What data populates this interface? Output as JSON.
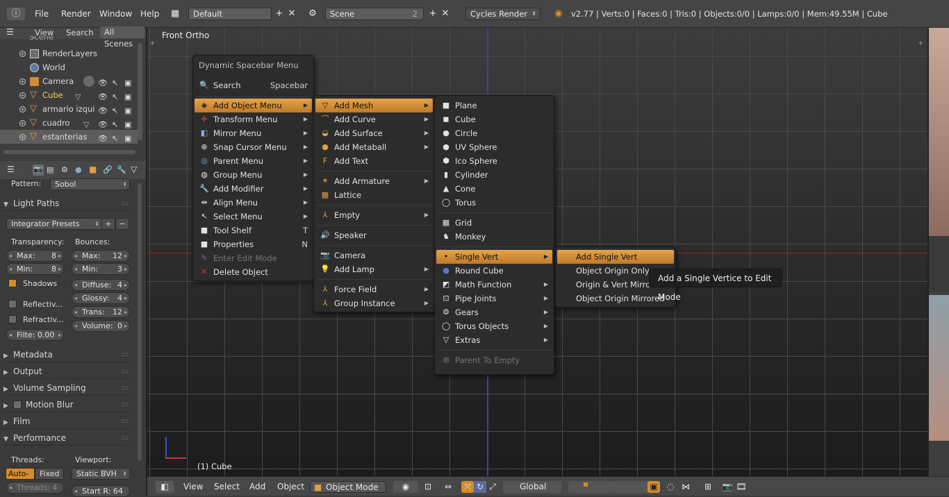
{
  "topbar": {
    "menus": [
      "File",
      "Render",
      "Window",
      "Help"
    ],
    "screen_layout": "Default",
    "scene": "Scene",
    "scene_users": "2",
    "render_engine": "Cycles Render",
    "stats": "v2.77 | Verts:0 | Faces:0 | Tris:0 | Objects:0/0 | Lamps:0/0 | Mem:49.55M | Cube"
  },
  "outliner": {
    "header_buttons": [
      "View",
      "Search",
      "All Scenes"
    ],
    "partial_top": "Scene",
    "rows": [
      {
        "label": "RenderLayers",
        "icon": "render-layers-icon"
      },
      {
        "label": "World",
        "icon": "world-icon"
      },
      {
        "label": "Camera",
        "icon": "camera-icon"
      },
      {
        "label": "Cube",
        "icon": "mesh-icon",
        "active": true
      },
      {
        "label": "armario izquier",
        "icon": "mesh-icon"
      },
      {
        "label": "cuadro",
        "icon": "mesh-icon"
      },
      {
        "label": "estanterias",
        "icon": "mesh-icon",
        "selected": true
      }
    ]
  },
  "properties": {
    "pattern_label": "Pattern:",
    "pattern_value": "Sobol",
    "light_paths": "Light Paths",
    "integrator_presets": "Integrator Presets",
    "transparency_label": "Transparency:",
    "bounces_label": "Bounces:",
    "t_max_label": "Max:",
    "t_max": "8",
    "t_min_label": "Min:",
    "t_min": "8",
    "b_max_label": "Max:",
    "b_max": "12",
    "b_min_label": "Min:",
    "b_min": "3",
    "shadows": "Shadows",
    "reflective": "Reflectiv...",
    "refractive": "Refractiv...",
    "filter_glossy": "Filte: 0.00",
    "diffuse_label": "Diffuse:",
    "diffuse": "4",
    "glossy_label": "Glossy:",
    "glossy": "4",
    "trans_label": "Trans:",
    "trans": "12",
    "volume_label": "Volume:",
    "volume": "0",
    "panels": [
      "Metadata",
      "Output",
      "Volume Sampling",
      "Motion Blur",
      "Film",
      "Performance"
    ],
    "threads_label": "Threads:",
    "viewport_label": "Viewport:",
    "auto_detect": "Auto-de",
    "fixed": "Fixed",
    "threads_value": "Threads: 4",
    "static_bvh": "Static BVH",
    "start_r": "Start R: 64"
  },
  "viewport": {
    "view_name": "Front Ortho",
    "object_label": "(1) Cube"
  },
  "menus": {
    "spacebar": {
      "title": "Dynamic Spacebar Menu",
      "search": "Search",
      "search_key": "Spacebar",
      "items": [
        {
          "label": "Add Object Menu",
          "icon": "add-object-icon",
          "submenu": true,
          "highlight": true
        },
        {
          "label": "Transform Menu",
          "icon": "transform-icon",
          "submenu": true
        },
        {
          "label": "Mirror Menu",
          "icon": "mirror-icon",
          "submenu": true
        },
        {
          "label": "Snap Cursor Menu",
          "icon": "snap-cursor-icon",
          "submenu": true
        },
        {
          "label": "Parent Menu",
          "icon": "parent-icon",
          "submenu": true
        },
        {
          "label": "Group Menu",
          "icon": "group-icon",
          "submenu": true
        },
        {
          "label": "Add Modifier",
          "icon": "wrench-icon",
          "submenu": true
        },
        {
          "label": "Align Menu",
          "icon": "align-icon",
          "submenu": true
        },
        {
          "label": "Select Menu",
          "icon": "select-icon",
          "submenu": true
        },
        {
          "label": "Tool Shelf",
          "icon": "tool-shelf-icon",
          "key": "T"
        },
        {
          "label": "Properties",
          "icon": "properties-icon",
          "key": "N"
        },
        {
          "label": "Enter Edit Mode",
          "icon": "edit-mode-icon",
          "disabled": true
        },
        {
          "label": "Delete Object",
          "icon": "delete-icon"
        }
      ]
    },
    "add_object": [
      {
        "label": "Add Mesh",
        "icon": "mesh-icon",
        "submenu": true,
        "highlight": true
      },
      {
        "label": "Add Curve",
        "icon": "curve-icon",
        "submenu": true
      },
      {
        "label": "Add Surface",
        "icon": "surface-icon",
        "submenu": true
      },
      {
        "label": "Add Metaball",
        "icon": "metaball-icon",
        "submenu": true
      },
      {
        "label": "Add Text",
        "icon": "text-icon"
      },
      {
        "label": "Add Armature",
        "icon": "armature-icon",
        "submenu": true
      },
      {
        "label": "Lattice",
        "icon": "lattice-icon"
      },
      {
        "label": "Empty",
        "icon": "empty-icon",
        "submenu": true
      },
      {
        "label": "Speaker",
        "icon": "speaker-icon"
      },
      {
        "label": "Camera",
        "icon": "camera-icon"
      },
      {
        "label": "Add Lamp",
        "icon": "lamp-icon",
        "submenu": true
      },
      {
        "label": "Force Field",
        "icon": "force-field-icon",
        "submenu": true
      },
      {
        "label": "Group Instance",
        "icon": "group-instance-icon",
        "submenu": true
      }
    ],
    "add_mesh": [
      {
        "label": "Plane",
        "icon": "plane-icon"
      },
      {
        "label": "Cube",
        "icon": "cube-icon"
      },
      {
        "label": "Circle",
        "icon": "circle-icon"
      },
      {
        "label": "UV Sphere",
        "icon": "uv-sphere-icon"
      },
      {
        "label": "Ico Sphere",
        "icon": "ico-sphere-icon"
      },
      {
        "label": "Cylinder",
        "icon": "cylinder-icon"
      },
      {
        "label": "Cone",
        "icon": "cone-icon"
      },
      {
        "label": "Torus",
        "icon": "torus-icon"
      },
      {
        "label": "Grid",
        "icon": "grid-icon"
      },
      {
        "label": "Monkey",
        "icon": "monkey-icon"
      },
      {
        "label": "Single Vert",
        "icon": "vertex-icon",
        "submenu": true,
        "highlight": true
      },
      {
        "label": "Round Cube",
        "icon": "round-cube-icon"
      },
      {
        "label": "Math Function",
        "icon": "math-function-icon",
        "submenu": true
      },
      {
        "label": "Pipe Joints",
        "icon": "pipe-joints-icon",
        "submenu": true
      },
      {
        "label": "Gears",
        "icon": "gears-icon",
        "submenu": true
      },
      {
        "label": "Torus Objects",
        "icon": "torus-objects-icon",
        "submenu": true
      },
      {
        "label": "Extras",
        "icon": "extras-icon",
        "submenu": true
      },
      {
        "label": "Parent To Empty",
        "icon": "parent-empty-icon",
        "disabled": true
      }
    ],
    "single_vert": [
      {
        "label": "Add Single Vert",
        "highlight": true
      },
      {
        "label": "Object Origin Only"
      },
      {
        "label": "Origin & Vert Mirrored"
      },
      {
        "label": "Object Origin Mirrored"
      }
    ]
  },
  "tooltip": "Add a Single Vertice to Edit Mode",
  "bottombar": {
    "menus": [
      "View",
      "Select",
      "Add",
      "Object"
    ],
    "mode": "Object Mode",
    "orientation": "Global"
  },
  "colors": {
    "highlight": "#d6923a",
    "menu_bg": "#2c2c2c",
    "active_text": "#e8d05a"
  }
}
